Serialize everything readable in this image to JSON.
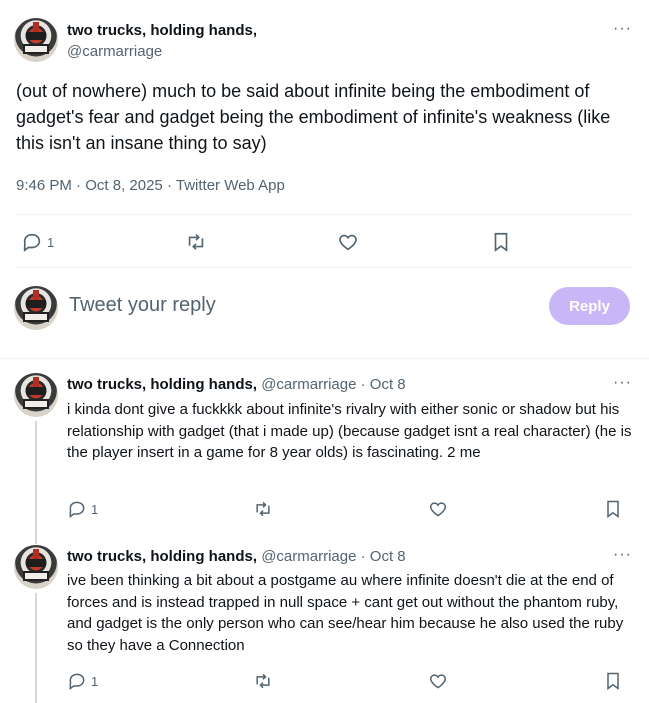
{
  "main_tweet": {
    "display_name": "two trucks, holding hands,",
    "handle": "@carmarriage",
    "text": "(out of nowhere) much to be said about infinite being the embodiment of gadget's fear and gadget being the embodiment of infinite's weakness (like this isn't an insane thing to say)",
    "time": "9:46 PM",
    "date": "Oct 8, 2025",
    "source": "Twitter Web App",
    "separator": "·",
    "reply_count": "1",
    "more_label": "···"
  },
  "reply_composer": {
    "placeholder": "Tweet your reply",
    "button_label": "Reply"
  },
  "thread": [
    {
      "display_name": "two trucks, holding hands,",
      "handle": "@carmarriage",
      "date": "Oct 8",
      "separator": "·",
      "text": "i kinda dont give a fuckkkk about infinite's rivalry with either sonic or shadow but his relationship with gadget (that i made up) (because gadget isnt a real character) (he is the player insert in a game for 8 year olds) is fascinating. 2 me",
      "reply_count": "1",
      "more_label": "···"
    },
    {
      "display_name": "two trucks, holding hands,",
      "handle": "@carmarriage",
      "date": "Oct 8",
      "separator": "·",
      "text": "ive been thinking a bit about a postgame au where infinite doesn't die at the end of forces and is instead trapped in null space + cant get out without the phantom ruby, and gadget is the only person who can see/hear him because he also used the ruby so they have a Connection",
      "reply_count": "1",
      "more_label": "···"
    }
  ],
  "colors": {
    "text": "#0f1419",
    "secondary": "#536471",
    "divider": "#eff3f4",
    "reply_button": "#c9b6f7"
  }
}
